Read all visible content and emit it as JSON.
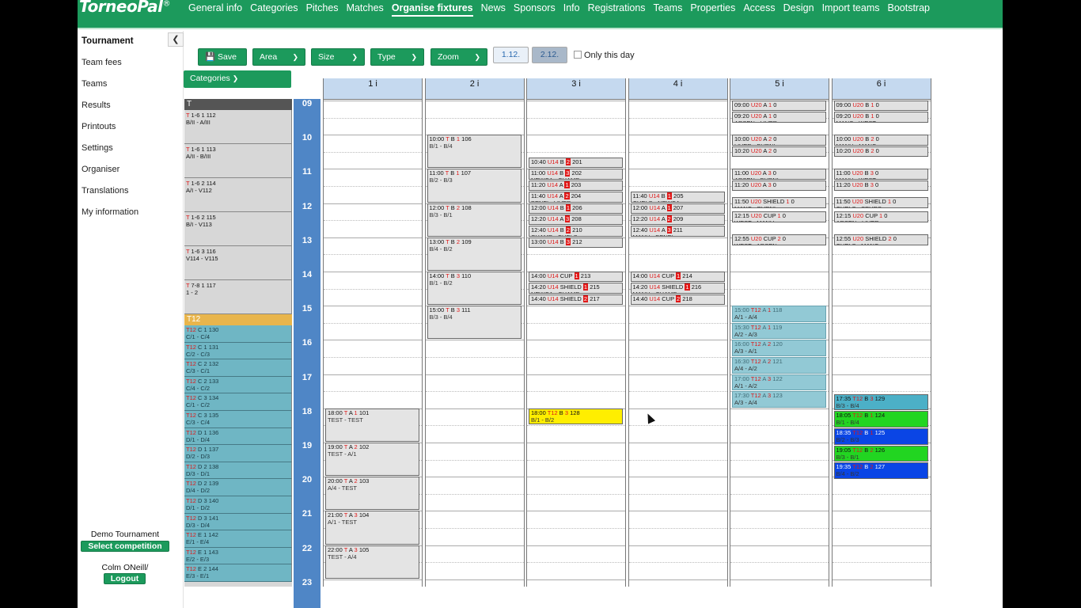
{
  "app": {
    "logo": "TorneoPal",
    "logo_mark": "®"
  },
  "nav": [
    {
      "label": "General info",
      "active": false
    },
    {
      "label": "Categories",
      "active": false
    },
    {
      "label": "Pitches",
      "active": false
    },
    {
      "label": "Matches",
      "active": false
    },
    {
      "label": "Organise fixtures",
      "active": true
    },
    {
      "label": "News",
      "active": false
    },
    {
      "label": "Sponsors",
      "active": false
    },
    {
      "label": "Info",
      "active": false
    },
    {
      "label": "Registrations",
      "active": false
    },
    {
      "label": "Teams",
      "active": false
    },
    {
      "label": "Properties",
      "active": false
    },
    {
      "label": "Access",
      "active": false
    },
    {
      "label": "Design",
      "active": false
    },
    {
      "label": "Import teams",
      "active": false
    },
    {
      "label": "Bootstrap",
      "active": false
    }
  ],
  "sidebar": {
    "title": "Tournament",
    "collapse_icon": "chevron-left-icon",
    "items": [
      "Team fees",
      "Teams",
      "Results",
      "Printouts",
      "Settings",
      "Organiser",
      "Translations",
      "My information"
    ],
    "competition": "Demo Tournament",
    "select_competition": "Select competition",
    "user": "Colm ONeill/",
    "logout": "Logout"
  },
  "toolbar": {
    "save": "Save",
    "save_icon": "floppy-disk-icon",
    "area": "Area",
    "size": "Size",
    "type": "Type",
    "zoom": "Zoom",
    "day1": "1.12.",
    "day2": "2.12.",
    "only_this_day": "Only this day",
    "categories": "Categories"
  },
  "colors": {
    "brand": "#1c9a5c",
    "hours": "#4f86c6",
    "pitch_header": "#c5d9ef",
    "t12_group": "#6fb6c4",
    "t12_header": "#e8b54c"
  },
  "category_groups": [
    {
      "name": "T",
      "header_color": "#555555",
      "items": [
        {
          "code": "T 1-6 1 112",
          "teams": "B/II - A/III"
        },
        {
          "code": "T 1-6 1 113",
          "teams": "A/II - B/III"
        },
        {
          "code": "T 1-6 2 114",
          "teams": "A/I - V112"
        },
        {
          "code": "T 1-6 2 115",
          "teams": "B/I - V113"
        },
        {
          "code": "T 1-6 3 116",
          "teams": "V114 - V115"
        },
        {
          "code": "T 7-8 1 117",
          "teams": "1 - 2"
        }
      ]
    },
    {
      "name": "T12",
      "header_color": "#e8b54c",
      "items": [
        {
          "code": "T12 C 1 130",
          "teams": "C/1 - C/4"
        },
        {
          "code": "T12 C 1 131",
          "teams": "C/2 - C/3"
        },
        {
          "code": "T12 C 2 132",
          "teams": "C/3 - C/1"
        },
        {
          "code": "T12 C 2 133",
          "teams": "C/4 - C/2"
        },
        {
          "code": "T12 C 3 134",
          "teams": "C/1 - C/2"
        },
        {
          "code": "T12 C 3 135",
          "teams": "C/3 - C/4"
        },
        {
          "code": "T12 D 1 136",
          "teams": "D/1 - D/4"
        },
        {
          "code": "T12 D 1 137",
          "teams": "D/2 - D/3"
        },
        {
          "code": "T12 D 2 138",
          "teams": "D/3 - D/1"
        },
        {
          "code": "T12 D 2 139",
          "teams": "D/4 - D/2"
        },
        {
          "code": "T12 D 3 140",
          "teams": "D/1 - D/2"
        },
        {
          "code": "T12 D 3 141",
          "teams": "D/3 - D/4"
        },
        {
          "code": "T12 E 1 142",
          "teams": "E/1 - E/4"
        },
        {
          "code": "T12 E 1 143",
          "teams": "E/2 - E/3"
        },
        {
          "code": "T12 E 2 144",
          "teams": "E/3 - E/1"
        }
      ]
    }
  ],
  "hours": [
    "09",
    "10",
    "11",
    "12",
    "13",
    "14",
    "15",
    "16",
    "17",
    "18",
    "19",
    "20",
    "21",
    "22",
    "23"
  ],
  "pitches": [
    "1 i",
    "2 i",
    "3 i",
    "4 i",
    "5 i",
    "6 i"
  ],
  "matches": [
    {
      "pitch": 0,
      "start": 18.0,
      "dur": 1.0,
      "style": "m-big",
      "time": "18:00",
      "cat": "T",
      "grp": "A",
      "rnd": "1",
      "num": "101",
      "teams": "TEST - TEST"
    },
    {
      "pitch": 0,
      "start": 19.0,
      "dur": 1.0,
      "style": "m-big",
      "time": "19:00",
      "cat": "T",
      "grp": "A",
      "rnd": "2",
      "num": "102",
      "teams": "TEST - A/1"
    },
    {
      "pitch": 0,
      "start": 20.0,
      "dur": 1.0,
      "style": "m-big",
      "time": "20:00",
      "cat": "T",
      "grp": "A",
      "rnd": "2",
      "num": "103",
      "teams": "A/4 - TEST"
    },
    {
      "pitch": 0,
      "start": 21.0,
      "dur": 1.0,
      "style": "m-big",
      "time": "21:00",
      "cat": "T",
      "grp": "A",
      "rnd": "3",
      "num": "104",
      "teams": "A/1 - TEST"
    },
    {
      "pitch": 0,
      "start": 22.0,
      "dur": 1.0,
      "style": "m-big",
      "time": "22:00",
      "cat": "T",
      "grp": "A",
      "rnd": "3",
      "num": "105",
      "teams": "TEST - A/4"
    },
    {
      "pitch": 1,
      "start": 10.0,
      "dur": 1.0,
      "style": "m-big",
      "time": "10:00",
      "cat": "T",
      "grp": "B",
      "rnd": "1",
      "num": "106",
      "teams": "B/1 - B/4"
    },
    {
      "pitch": 1,
      "start": 11.0,
      "dur": 1.0,
      "style": "m-big",
      "time": "11:00",
      "cat": "T",
      "grp": "B",
      "rnd": "1",
      "num": "107",
      "teams": "B/2 - B/3"
    },
    {
      "pitch": 1,
      "start": 12.0,
      "dur": 1.0,
      "style": "m-big",
      "time": "12:00",
      "cat": "T",
      "grp": "B",
      "rnd": "2",
      "num": "108",
      "teams": "B/3 - B/1"
    },
    {
      "pitch": 1,
      "start": 13.0,
      "dur": 1.0,
      "style": "m-big",
      "time": "13:00",
      "cat": "T",
      "grp": "B",
      "rnd": "2",
      "num": "109",
      "teams": "B/4 - B/2"
    },
    {
      "pitch": 1,
      "start": 14.0,
      "dur": 1.0,
      "style": "m-big",
      "time": "14:00",
      "cat": "T",
      "grp": "B",
      "rnd": "3",
      "num": "110",
      "teams": "B/1 - B/2"
    },
    {
      "pitch": 1,
      "start": 15.0,
      "dur": 1.0,
      "style": "m-big",
      "time": "15:00",
      "cat": "T",
      "grp": "B",
      "rnd": "3",
      "num": "111",
      "teams": "B/3 - B/4"
    },
    {
      "pitch": 2,
      "start": 10.667,
      "dur": 0.333,
      "style": "",
      "time": "10:40",
      "cat": "U14",
      "grp": "B",
      "rnd": "2",
      "num": "201",
      "teams": "NEWCA - PARCE",
      "rbox": true
    },
    {
      "pitch": 2,
      "start": 11.0,
      "dur": 0.333,
      "style": "",
      "time": "11:00",
      "cat": "U14",
      "grp": "B",
      "rnd": "3",
      "num": "202",
      "teams": "NEWCA - CHAMP",
      "rbox": true
    },
    {
      "pitch": 2,
      "start": 11.333,
      "dur": 0.333,
      "style": "",
      "time": "11:20",
      "cat": "U14",
      "grp": "A",
      "rnd": "1",
      "num": "203",
      "teams": "LIVER - MANU",
      "rbox": true
    },
    {
      "pitch": 2,
      "start": 11.667,
      "dur": 0.333,
      "style": "",
      "time": "11:40",
      "cat": "U14",
      "grp": "A",
      "rnd": "2",
      "num": "204",
      "teams": "BENFI - LIVER",
      "rbox": true
    },
    {
      "pitch": 2,
      "start": 12.0,
      "dur": 0.333,
      "style": "",
      "time": "12:00",
      "cat": "U14",
      "grp": "B",
      "rnd": "1",
      "num": "206",
      "teams": "PARCE - CHAMP",
      "rbox": true
    },
    {
      "pitch": 2,
      "start": 12.333,
      "dur": 0.333,
      "style": "",
      "time": "12:20",
      "cat": "U14",
      "grp": "A",
      "rnd": "3",
      "num": "208",
      "teams": "AJAX - BENFI",
      "rbox": true
    },
    {
      "pitch": 2,
      "start": 12.667,
      "dur": 0.333,
      "style": "",
      "time": "12:40",
      "cat": "U14",
      "grp": "B",
      "rnd": "2",
      "num": "210",
      "teams": "CHAMP - CHELS",
      "rbox": true
    },
    {
      "pitch": 2,
      "start": 13.0,
      "dur": 0.333,
      "style": "",
      "time": "13:00",
      "cat": "U14",
      "grp": "B",
      "rnd": "3",
      "num": "212",
      "teams": "PARCE - CHELS",
      "rbox": true
    },
    {
      "pitch": 2,
      "start": 14.0,
      "dur": 0.333,
      "style": "",
      "time": "14:00",
      "cat": "U14",
      "grp": "CUP",
      "rnd": "1",
      "num": "213",
      "teams": "PARCE - CHELS",
      "rbox": true
    },
    {
      "pitch": 2,
      "start": 14.333,
      "dur": 0.333,
      "style": "",
      "time": "14:20",
      "cat": "U14",
      "grp": "SHIELD",
      "rnd": "1",
      "num": "215",
      "teams": "NEWCA - CHAMP",
      "rbox": true
    },
    {
      "pitch": 2,
      "start": 14.667,
      "dur": 0.333,
      "style": "",
      "time": "14:40",
      "cat": "U14",
      "grp": "SHIELD",
      "rnd": "2",
      "num": "217",
      "teams": "CHAMP - LIVER",
      "rbox": true
    },
    {
      "pitch": 2,
      "start": 18.0,
      "dur": 0.5,
      "style": "m-yellow",
      "time": "18:00",
      "cat": "T12",
      "grp": "B",
      "rnd": "3",
      "num": "128",
      "teams": "B/1 - B/2"
    },
    {
      "pitch": 3,
      "start": 11.667,
      "dur": 0.333,
      "style": "",
      "time": "11:40",
      "cat": "U14",
      "grp": "B",
      "rnd": "1",
      "num": "205",
      "teams": "CHELS - NEWCA",
      "rbox": true
    },
    {
      "pitch": 3,
      "start": 12.0,
      "dur": 0.333,
      "style": "",
      "time": "12:00",
      "cat": "U14",
      "grp": "A",
      "rnd": "1",
      "num": "207",
      "teams": "AJAX - BENFI",
      "rbox": true
    },
    {
      "pitch": 3,
      "start": 12.333,
      "dur": 0.333,
      "style": "",
      "time": "12:20",
      "cat": "U14",
      "grp": "A",
      "rnd": "2",
      "num": "209",
      "teams": "MANU - AJAX",
      "rbox": true
    },
    {
      "pitch": 3,
      "start": 12.667,
      "dur": 0.333,
      "style": "",
      "time": "12:40",
      "cat": "U14",
      "grp": "A",
      "rnd": "3",
      "num": "211",
      "teams": "MANU - BENFI",
      "rbox": true
    },
    {
      "pitch": 3,
      "start": 14.0,
      "dur": 0.333,
      "style": "",
      "time": "14:00",
      "cat": "U14",
      "grp": "CUP",
      "rnd": "1",
      "num": "214",
      "teams": "AJAX - BENFI",
      "rbox": true
    },
    {
      "pitch": 3,
      "start": 14.333,
      "dur": 0.333,
      "style": "",
      "time": "14:20",
      "cat": "U14",
      "grp": "SHIELD",
      "rnd": "1",
      "num": "216",
      "teams": "MANU - CHAMP",
      "rbox": true
    },
    {
      "pitch": 3,
      "start": 14.667,
      "dur": 0.333,
      "style": "",
      "time": "14:40",
      "cat": "U14",
      "grp": "CUP",
      "rnd": "2",
      "num": "218",
      "teams": "BENFI - CHELS",
      "rbox": true
    },
    {
      "pitch": 4,
      "start": 9.0,
      "dur": 0.333,
      "style": "",
      "time": "09:00",
      "cat": "U20",
      "grp": "A",
      "rnd": "1",
      "num": "0",
      "teams": "BURNL - CHELS"
    },
    {
      "pitch": 4,
      "start": 9.333,
      "dur": 0.333,
      "style": "",
      "time": "09:20",
      "cat": "U20",
      "grp": "A",
      "rnd": "1",
      "num": "0",
      "teams": "ARSEN - LIVER"
    },
    {
      "pitch": 4,
      "start": 10.0,
      "dur": 0.333,
      "style": "",
      "time": "10:00",
      "cat": "U20",
      "grp": "A",
      "rnd": "2",
      "num": "0",
      "teams": "LIVER - BURNL"
    },
    {
      "pitch": 4,
      "start": 10.333,
      "dur": 0.333,
      "style": "",
      "time": "10:20",
      "cat": "U20",
      "grp": "A",
      "rnd": "2",
      "num": "0",
      "teams": "CHELS - ARSEN"
    },
    {
      "pitch": 4,
      "start": 11.0,
      "dur": 0.333,
      "style": "",
      "time": "11:00",
      "cat": "U20",
      "grp": "A",
      "rnd": "3",
      "num": "0",
      "teams": "ARSEN - BURNL"
    },
    {
      "pitch": 4,
      "start": 11.333,
      "dur": 0.333,
      "style": "",
      "time": "11:20",
      "cat": "U20",
      "grp": "A",
      "rnd": "3",
      "num": "0",
      "teams": "CHELS - LIVER"
    },
    {
      "pitch": 4,
      "start": 11.833,
      "dur": 0.333,
      "style": "",
      "time": "11:50",
      "cat": "U20",
      "grp": "SHIELD",
      "rnd": "1",
      "num": "0",
      "teams": "MANC - BURNL"
    },
    {
      "pitch": 4,
      "start": 12.25,
      "dur": 0.333,
      "style": "",
      "time": "12:15",
      "cat": "U20",
      "grp": "CUP",
      "rnd": "1",
      "num": "0",
      "teams": "WEST - MANU"
    },
    {
      "pitch": 4,
      "start": 12.917,
      "dur": 0.333,
      "style": "",
      "time": "12:55",
      "cat": "U20",
      "grp": "CUP",
      "rnd": "2",
      "num": "0",
      "teams": "WEST - ARSEN"
    },
    {
      "pitch": 4,
      "start": 15.0,
      "dur": 0.5,
      "style": "m-cyan",
      "time": "15:00",
      "cat": "T12",
      "grp": "A",
      "rnd": "1",
      "num": "118",
      "teams": "A/1 - A/4"
    },
    {
      "pitch": 4,
      "start": 15.5,
      "dur": 0.5,
      "style": "m-cyan",
      "time": "15:30",
      "cat": "T12",
      "grp": "A",
      "rnd": "1",
      "num": "119",
      "teams": "A/2 - A/3"
    },
    {
      "pitch": 4,
      "start": 16.0,
      "dur": 0.5,
      "style": "m-cyan",
      "time": "16:00",
      "cat": "T12",
      "grp": "A",
      "rnd": "2",
      "num": "120",
      "teams": "A/3 - A/1"
    },
    {
      "pitch": 4,
      "start": 16.5,
      "dur": 0.5,
      "style": "m-cyan",
      "time": "16:30",
      "cat": "T12",
      "grp": "A",
      "rnd": "2",
      "num": "121",
      "teams": "A/4 - A/2"
    },
    {
      "pitch": 4,
      "start": 17.0,
      "dur": 0.5,
      "style": "m-cyan",
      "time": "17:00",
      "cat": "T12",
      "grp": "A",
      "rnd": "3",
      "num": "122",
      "teams": "A/1 - A/2"
    },
    {
      "pitch": 4,
      "start": 17.5,
      "dur": 0.5,
      "style": "m-cyan",
      "time": "17:30",
      "cat": "T12",
      "grp": "A",
      "rnd": "3",
      "num": "123",
      "teams": "A/3 - A/4"
    },
    {
      "pitch": 5,
      "start": 9.0,
      "dur": 0.333,
      "style": "",
      "time": "09:00",
      "cat": "U20",
      "grp": "B",
      "rnd": "1",
      "num": "0",
      "teams": "BURNL - MANU"
    },
    {
      "pitch": 5,
      "start": 9.333,
      "dur": 0.333,
      "style": "",
      "time": "09:20",
      "cat": "U20",
      "grp": "B",
      "rnd": "1",
      "num": "0",
      "teams": "MANC - WEST"
    },
    {
      "pitch": 5,
      "start": 10.0,
      "dur": 0.333,
      "style": "",
      "time": "10:00",
      "cat": "U20",
      "grp": "B",
      "rnd": "2",
      "num": "0",
      "teams": "MANU - MANC"
    },
    {
      "pitch": 5,
      "start": 10.333,
      "dur": 0.333,
      "style": "",
      "time": "10:20",
      "cat": "U20",
      "grp": "B",
      "rnd": "2",
      "num": "0",
      "teams": "WEST - SPURS"
    },
    {
      "pitch": 5,
      "start": 11.0,
      "dur": 0.333,
      "style": "",
      "time": "11:00",
      "cat": "U20",
      "grp": "B",
      "rnd": "3",
      "num": "0",
      "teams": "MANU - WEST"
    },
    {
      "pitch": 5,
      "start": 11.333,
      "dur": 0.333,
      "style": "",
      "time": "11:20",
      "cat": "U20",
      "grp": "B",
      "rnd": "3",
      "num": "0",
      "teams": "MANC - SPURS"
    },
    {
      "pitch": 5,
      "start": 11.833,
      "dur": 0.333,
      "style": "",
      "time": "11:50",
      "cat": "U20",
      "grp": "SHIELD",
      "rnd": "1",
      "num": "0",
      "teams": "CHELS - SPURS"
    },
    {
      "pitch": 5,
      "start": 12.25,
      "dur": 0.333,
      "style": "",
      "time": "12:15",
      "cat": "U20",
      "grp": "CUP",
      "rnd": "1",
      "num": "0",
      "teams": "ARSEN - LIVER"
    },
    {
      "pitch": 5,
      "start": 12.917,
      "dur": 0.333,
      "style": "",
      "time": "12:55",
      "cat": "U20",
      "grp": "SHIELD",
      "rnd": "2",
      "num": "0",
      "teams": "CHELS - MANC"
    },
    {
      "pitch": 5,
      "start": 17.583,
      "dur": 0.5,
      "style": "m-teal",
      "time": "17:35",
      "cat": "T12",
      "grp": "B",
      "rnd": "3",
      "num": "129",
      "teams": "B/3 - B/4"
    },
    {
      "pitch": 5,
      "start": 18.083,
      "dur": 0.5,
      "style": "m-green",
      "time": "18:05",
      "cat": "T12",
      "grp": "B",
      "rnd": "1",
      "num": "124",
      "teams": "B/1 - B/4"
    },
    {
      "pitch": 5,
      "start": 18.583,
      "dur": 0.5,
      "style": "m-blue",
      "time": "18:35",
      "cat": "T12",
      "grp": "B",
      "rnd": "1",
      "num": "125",
      "teams": "B/2 - B/3"
    },
    {
      "pitch": 5,
      "start": 19.083,
      "dur": 0.5,
      "style": "m-green",
      "time": "19:05",
      "cat": "T12",
      "grp": "B",
      "rnd": "2",
      "num": "126",
      "teams": "B/3 - B/1"
    },
    {
      "pitch": 5,
      "start": 19.583,
      "dur": 0.5,
      "style": "m-blue",
      "time": "19:35",
      "cat": "T12",
      "grp": "B",
      "rnd": "2",
      "num": "127",
      "teams": "B/4 - B/2"
    }
  ]
}
